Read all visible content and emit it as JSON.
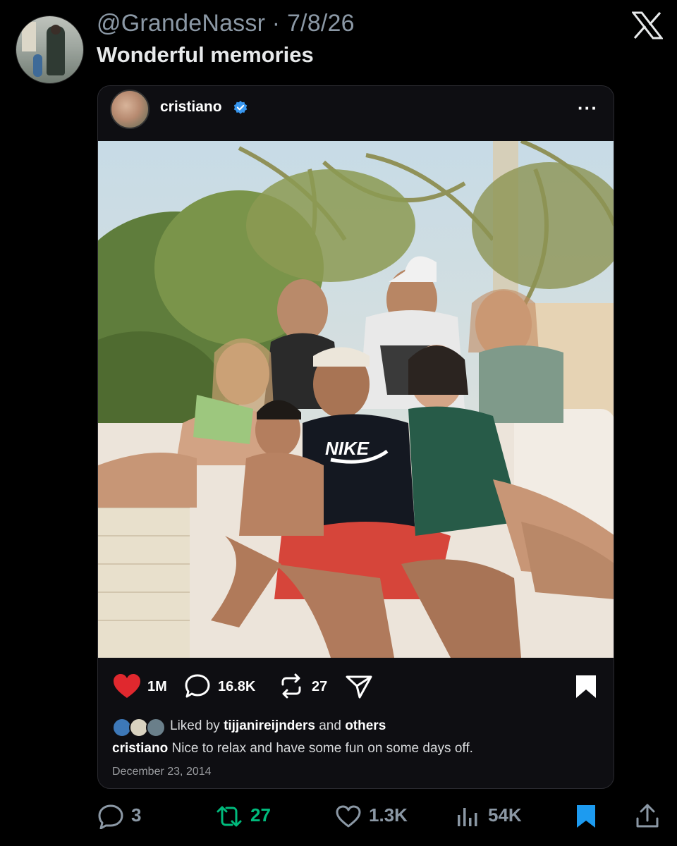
{
  "tweet": {
    "handle": "@GrandeNassr",
    "separator": "·",
    "date": "7/8/26",
    "text": "Wonderful memories"
  },
  "embedded_post": {
    "username": "cristiano",
    "verified": true,
    "menu_icon": "more-icon",
    "likes": "1M",
    "comments": "16.8K",
    "reposts": "27",
    "liked_by_prefix": "Liked by",
    "liked_by_user": "tijjanireijnders",
    "liked_by_joiner": "and",
    "liked_by_others": "others",
    "caption_user": "cristiano",
    "caption_text": "Nice to relax and have some fun on some days off.",
    "date": "December 23, 2014",
    "photo_text": "NIKE"
  },
  "footer": {
    "replies": "3",
    "retweets": "27",
    "likes": "1.3K",
    "views": "54K"
  },
  "colors": {
    "background": "#000000",
    "like_red": "#e0282e",
    "verified_blue": "#3897f0",
    "retweet_green": "#00ba7c",
    "bookmark_blue": "#1d9bf0",
    "muted": "#8b98a5"
  }
}
